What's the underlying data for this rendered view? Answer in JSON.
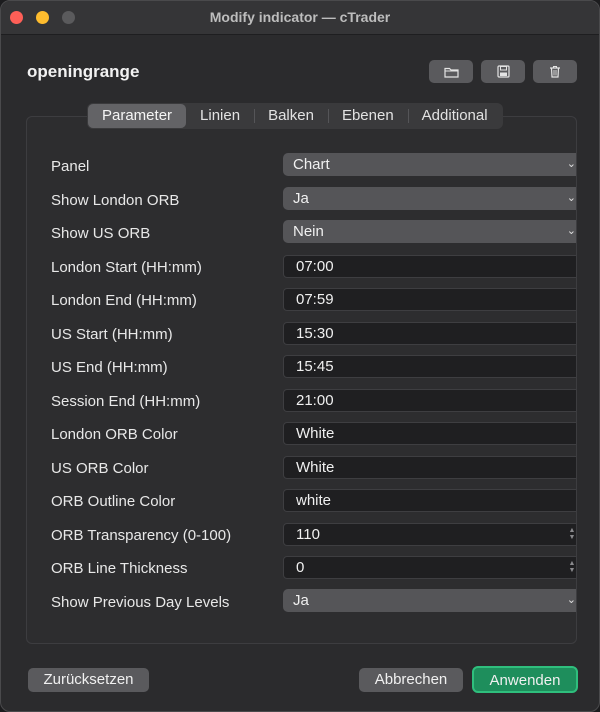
{
  "window": {
    "title": "Modify indicator — cTrader"
  },
  "header": {
    "indicator_name": "openingrange",
    "icons": [
      "folder-icon",
      "save-icon",
      "trash-icon"
    ]
  },
  "tabs": [
    {
      "label": "Parameter",
      "active": true
    },
    {
      "label": "Linien",
      "active": false
    },
    {
      "label": "Balken",
      "active": false
    },
    {
      "label": "Ebenen",
      "active": false
    },
    {
      "label": "Additional",
      "active": false
    }
  ],
  "parameters": [
    {
      "label": "Panel",
      "type": "select",
      "value": "Chart"
    },
    {
      "label": "Show London ORB",
      "type": "select",
      "value": "Ja"
    },
    {
      "label": "Show US ORB",
      "type": "select",
      "value": "Nein"
    },
    {
      "label": "London Start (HH:mm)",
      "type": "text",
      "value": "07:00"
    },
    {
      "label": "London End (HH:mm)",
      "type": "text",
      "value": "07:59"
    },
    {
      "label": "US Start (HH:mm)",
      "type": "text",
      "value": "15:30"
    },
    {
      "label": "US End (HH:mm)",
      "type": "text",
      "value": "15:45"
    },
    {
      "label": "Session End (HH:mm)",
      "type": "text",
      "value": "21:00"
    },
    {
      "label": "London ORB Color",
      "type": "text",
      "value": "White"
    },
    {
      "label": "US ORB Color",
      "type": "text",
      "value": "White"
    },
    {
      "label": "ORB Outline Color",
      "type": "text",
      "value": "white"
    },
    {
      "label": "ORB Transparency (0-100)",
      "type": "number",
      "value": "110"
    },
    {
      "label": "ORB Line Thickness",
      "type": "number",
      "value": "0"
    },
    {
      "label": "Show Previous Day Levels",
      "type": "select",
      "value": "Ja"
    }
  ],
  "footer": {
    "reset_label": "Zurücksetzen",
    "cancel_label": "Abbrechen",
    "apply_label": "Anwenden"
  },
  "colors": {
    "accent": "#1e8e5c",
    "accent_border": "#2fbf7d"
  }
}
